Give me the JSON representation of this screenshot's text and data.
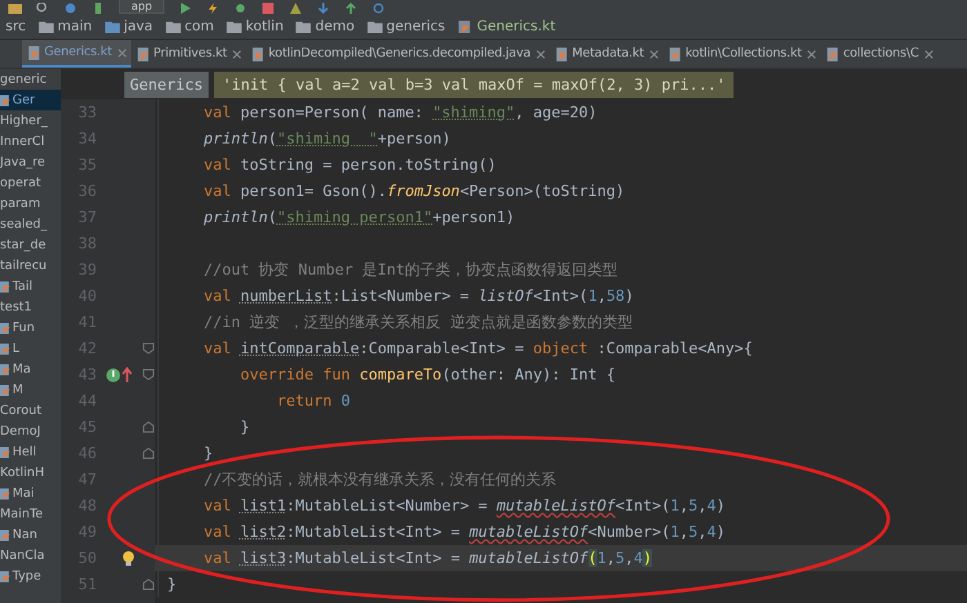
{
  "toolbar": {
    "run_config": "app"
  },
  "breadcrumbs": [
    {
      "label": "src",
      "kind": "plain"
    },
    {
      "label": "main",
      "kind": "folder"
    },
    {
      "label": "java",
      "kind": "source"
    },
    {
      "label": "com",
      "kind": "folder"
    },
    {
      "label": "kotlin",
      "kind": "folder"
    },
    {
      "label": "demo",
      "kind": "folder"
    },
    {
      "label": "generics",
      "kind": "folder"
    },
    {
      "label": "Generics.kt",
      "kind": "file"
    }
  ],
  "tabs": [
    {
      "label": "Generics.kt",
      "selected": true
    },
    {
      "label": "Primitives.kt",
      "selected": false
    },
    {
      "label": "kotlinDecompiled\\Generics.decompiled.java",
      "selected": false
    },
    {
      "label": "Metadata.kt",
      "selected": false
    },
    {
      "label": "kotlin\\Collections.kt",
      "selected": false
    },
    {
      "label": "collections\\C",
      "selected": false
    }
  ],
  "tooltip": {
    "name": "Generics",
    "value": "'init { val a=2 val b=3 val maxOf = maxOf(2, 3) pri...'"
  },
  "project_items": [
    {
      "label": "generic",
      "icon": false,
      "selected": false
    },
    {
      "label": "Ger",
      "icon": true,
      "selected": true
    },
    {
      "label": "Higher_",
      "icon": false,
      "selected": false
    },
    {
      "label": "InnerCl",
      "icon": false,
      "selected": false
    },
    {
      "label": "Java_re",
      "icon": false,
      "selected": false
    },
    {
      "label": "operat",
      "icon": false,
      "selected": false
    },
    {
      "label": "param",
      "icon": false,
      "selected": false
    },
    {
      "label": "sealed_",
      "icon": false,
      "selected": false
    },
    {
      "label": "star_de",
      "icon": false,
      "selected": false
    },
    {
      "label": "tailrecu",
      "icon": false,
      "selected": false
    },
    {
      "label": "Tail",
      "icon": true,
      "selected": false
    },
    {
      "label": "test1",
      "icon": false,
      "selected": false
    },
    {
      "label": "Fun",
      "icon": true,
      "selected": false
    },
    {
      "label": "L",
      "icon": true,
      "selected": false
    },
    {
      "label": "Ma",
      "icon": true,
      "selected": false
    },
    {
      "label": "M",
      "icon": true,
      "selected": false
    },
    {
      "label": "Corout",
      "icon": false,
      "selected": false
    },
    {
      "label": "DemoJ",
      "icon": false,
      "selected": false
    },
    {
      "label": "Hell",
      "icon": true,
      "selected": false
    },
    {
      "label": "KotlinH",
      "icon": false,
      "selected": false
    },
    {
      "label": "Mai",
      "icon": true,
      "selected": false
    },
    {
      "label": "MainTe",
      "icon": false,
      "selected": false
    },
    {
      "label": "Nan",
      "icon": true,
      "selected": false
    },
    {
      "label": "NanCla",
      "icon": false,
      "selected": false
    },
    {
      "label": "Type",
      "icon": true,
      "selected": false
    }
  ],
  "lines": [
    {
      "number": "33",
      "kind": "plain",
      "current": false,
      "tokens": [
        {
          "kind": "keyword",
          "text": "    val"
        },
        {
          "kind": "plain",
          "text": " person=Person( name: "
        },
        {
          "kind": "string",
          "text": "\"shiming\""
        },
        {
          "kind": "plain",
          "text": ", age=20)"
        }
      ]
    },
    {
      "number": "34",
      "kind": "plain",
      "current": false,
      "tokens": [
        {
          "kind": "call",
          "text": "    println"
        },
        {
          "kind": "plain",
          "text": "("
        },
        {
          "kind": "string",
          "text": "\"shiming  \""
        },
        {
          "kind": "plain",
          "text": "+person)"
        }
      ]
    },
    {
      "number": "35",
      "kind": "plain",
      "current": false,
      "tokens": [
        {
          "kind": "keyword",
          "text": "    val"
        },
        {
          "kind": "plain",
          "text": " toString = person.toString()"
        }
      ]
    },
    {
      "number": "36",
      "kind": "plain",
      "current": false,
      "tokens": [
        {
          "kind": "keyword",
          "text": "    val"
        },
        {
          "kind": "plain",
          "text": " person1= Gson()."
        },
        {
          "kind": "method-call",
          "text": "fromJson"
        },
        {
          "kind": "plain",
          "text": "<Person>(toString)"
        }
      ]
    },
    {
      "number": "37",
      "kind": "plain",
      "current": false,
      "tokens": [
        {
          "kind": "call",
          "text": "    println"
        },
        {
          "kind": "plain",
          "text": "("
        },
        {
          "kind": "string",
          "text": "\"shiming person1\""
        },
        {
          "kind": "plain",
          "text": "+person1)"
        }
      ]
    },
    {
      "number": "38",
      "kind": "plain",
      "current": false
    },
    {
      "number": "39",
      "kind": "plain",
      "current": false,
      "tokens": [
        {
          "kind": "comment",
          "text": "    //out 协变 Number 是Int的子类，协变点函数得返回类型"
        }
      ]
    },
    {
      "number": "40",
      "kind": "plain",
      "current": false,
      "tokens": [
        {
          "kind": "keyword",
          "text": "    val "
        },
        {
          "kind": "decl",
          "text": "numberList"
        },
        {
          "kind": "plain",
          "text": ":List<Number> = "
        },
        {
          "kind": "call",
          "text": "listOf"
        },
        {
          "kind": "plain",
          "text": "<Int>("
        },
        {
          "kind": "number",
          "text": "1"
        },
        {
          "kind": "plain",
          "text": ","
        },
        {
          "kind": "number",
          "text": "58"
        },
        {
          "kind": "plain",
          "text": ")"
        }
      ]
    },
    {
      "number": "41",
      "kind": "plain",
      "current": false,
      "tokens": [
        {
          "kind": "comment",
          "text": "    //in 逆变 ，泛型的继承关系相反 逆变点就是函数参数的类型"
        }
      ]
    },
    {
      "number": "42",
      "kind": "fold-start",
      "current": false,
      "tokens": [
        {
          "kind": "keyword",
          "text": "    val "
        },
        {
          "kind": "decl",
          "text": "intComparable"
        },
        {
          "kind": "plain",
          "text": ":Comparable<Int> = "
        },
        {
          "kind": "keyword",
          "text": "object"
        },
        {
          "kind": "plain",
          "text": " :Comparable<Any>{"
        }
      ]
    },
    {
      "number": "43",
      "kind": "override",
      "current": false,
      "tokens": [
        {
          "kind": "keyword",
          "text": "        override fun "
        },
        {
          "kind": "method",
          "text": "compareTo"
        },
        {
          "kind": "plain",
          "text": "(other: Any): Int {"
        }
      ]
    },
    {
      "number": "44",
      "kind": "plain",
      "current": false,
      "tokens": [
        {
          "kind": "keyword",
          "text": "            return "
        },
        {
          "kind": "number",
          "text": "0"
        }
      ]
    },
    {
      "number": "45",
      "kind": "fold-end",
      "current": false,
      "tokens": [
        {
          "kind": "plain",
          "text": "        }"
        }
      ]
    },
    {
      "number": "46",
      "kind": "fold-end",
      "current": false,
      "tokens": [
        {
          "kind": "plain",
          "text": "    }"
        }
      ]
    },
    {
      "number": "47",
      "kind": "plain",
      "current": false,
      "tokens": [
        {
          "kind": "comment",
          "text": "    //不变的话，就根本没有继承关系，没有任何的关系"
        }
      ]
    },
    {
      "number": "48",
      "kind": "plain",
      "current": false,
      "tokens": [
        {
          "kind": "keyword",
          "text": "    val "
        },
        {
          "kind": "decl",
          "text": "list1"
        },
        {
          "kind": "plain",
          "text": ":MutableList<Number> = "
        },
        {
          "kind": "call-error",
          "text": "mutableListOf"
        },
        {
          "kind": "plain",
          "text": "<Int>("
        },
        {
          "kind": "number",
          "text": "1"
        },
        {
          "kind": "plain",
          "text": ","
        },
        {
          "kind": "number",
          "text": "5"
        },
        {
          "kind": "plain",
          "text": ","
        },
        {
          "kind": "number",
          "text": "4"
        },
        {
          "kind": "plain",
          "text": ")"
        }
      ]
    },
    {
      "number": "49",
      "kind": "plain",
      "current": false,
      "tokens": [
        {
          "kind": "keyword",
          "text": "    val "
        },
        {
          "kind": "decl",
          "text": "list2"
        },
        {
          "kind": "plain",
          "text": ":MutableList<Int> = "
        },
        {
          "kind": "call-error",
          "text": "mutableListOf"
        },
        {
          "kind": "plain",
          "text": "<Number>("
        },
        {
          "kind": "number",
          "text": "1"
        },
        {
          "kind": "plain",
          "text": ","
        },
        {
          "kind": "number",
          "text": "5"
        },
        {
          "kind": "plain",
          "text": ","
        },
        {
          "kind": "number",
          "text": "4"
        },
        {
          "kind": "plain",
          "text": ")"
        }
      ]
    },
    {
      "number": "50",
      "kind": "bulb",
      "current": true,
      "tokens": [
        {
          "kind": "keyword",
          "text": "    val "
        },
        {
          "kind": "decl",
          "text": "list3"
        },
        {
          "kind": "plain",
          "text": ":MutableList<Int> = "
        },
        {
          "kind": "call",
          "text": "mutableListOf"
        },
        {
          "kind": "paren-match",
          "text": "("
        },
        {
          "kind": "number",
          "text": "1"
        },
        {
          "kind": "plain",
          "text": ","
        },
        {
          "kind": "number",
          "text": "5"
        },
        {
          "kind": "plain",
          "text": ","
        },
        {
          "kind": "number",
          "text": "4"
        },
        {
          "kind": "paren-match",
          "text": ")"
        }
      ]
    },
    {
      "number": "51",
      "kind": "fold-end",
      "current": false,
      "tokens": [
        {
          "kind": "plain",
          "text": "}"
        }
      ]
    }
  ]
}
